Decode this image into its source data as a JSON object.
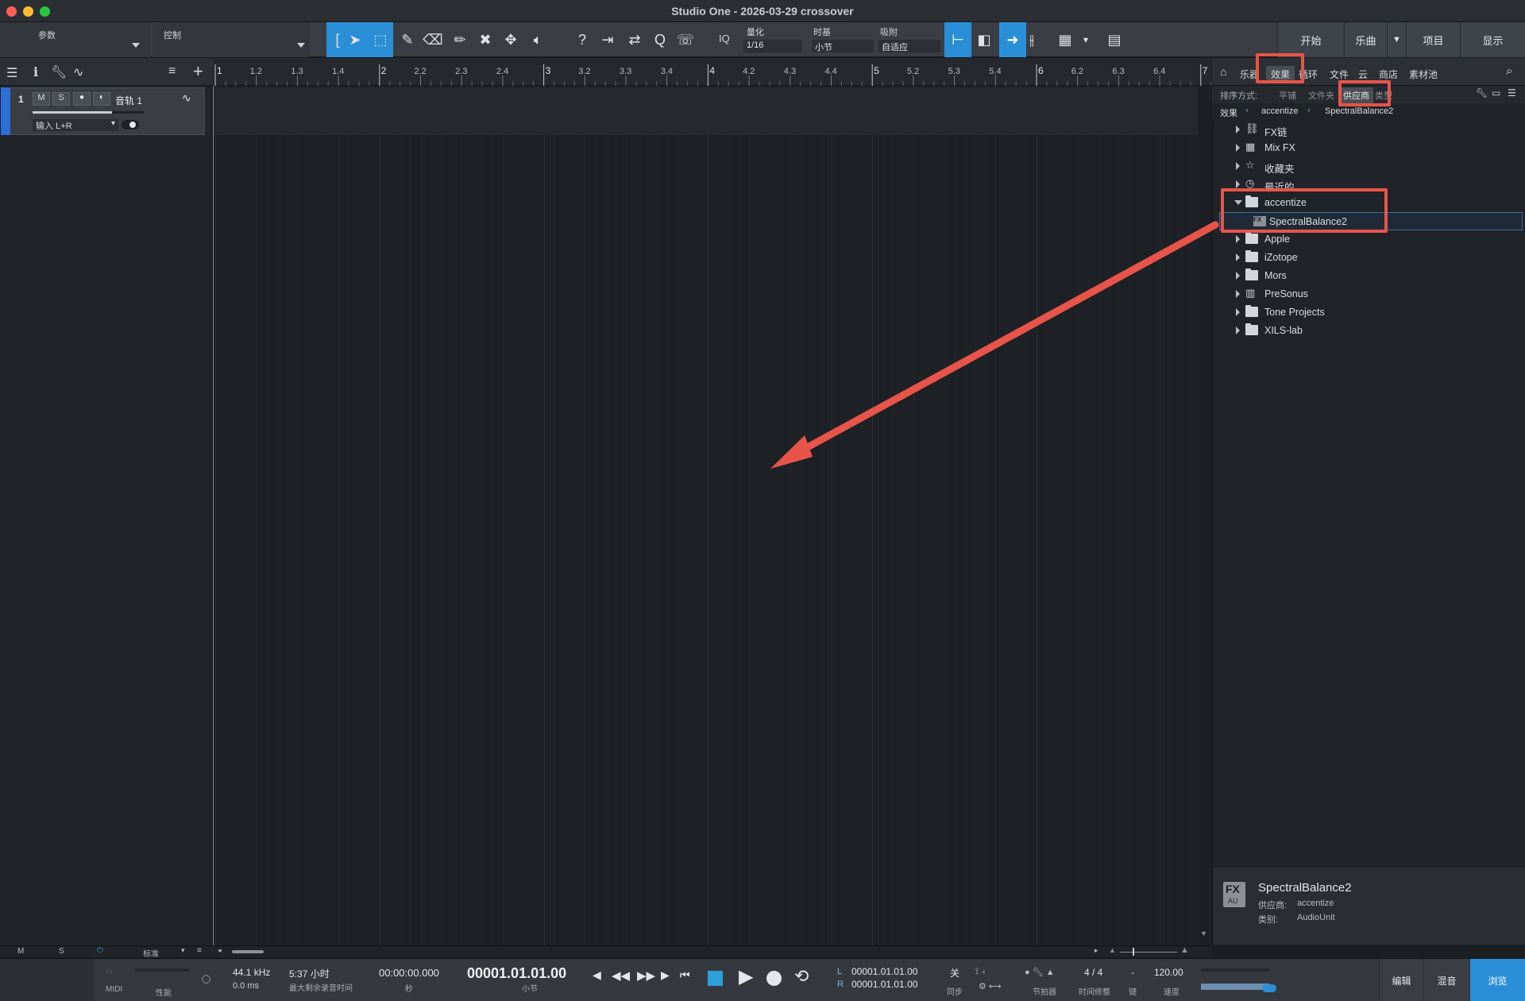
{
  "window": {
    "title": "Studio One - 2026-03-29 crossover"
  },
  "toolbar": {
    "params_label": "参数",
    "control_label": "控制",
    "quantize": {
      "label": "量化",
      "value": "1/16"
    },
    "timebase": {
      "label": "时基",
      "value": "小节"
    },
    "snap": {
      "label": "吸附",
      "value": "自适应"
    },
    "iq": "IQ",
    "right_tabs": [
      "开始",
      "乐曲",
      "项目",
      "显示"
    ]
  },
  "ruler": {
    "labels": [
      "1",
      "1.2",
      "1.3",
      "1.4",
      "2",
      "2.2",
      "2.3",
      "2.4",
      "3",
      "3.2",
      "3.3",
      "3.4",
      "4",
      "4.2",
      "4.3",
      "4.4",
      "5",
      "5.2",
      "5.3",
      "5.4",
      "6",
      "6.2",
      "6.3",
      "6.4",
      "7"
    ]
  },
  "track": {
    "number": "1",
    "name": "音轨 1",
    "mute": "M",
    "solo": "S",
    "input": "输入 L+R"
  },
  "browser": {
    "tabs": [
      "乐器",
      "效果",
      "循环",
      "文件",
      "云",
      "商店",
      "素材池"
    ],
    "sort_label": "排序方式:",
    "sort_options": [
      "平铺",
      "文件夹",
      "供应商",
      "类型"
    ],
    "breadcrumb": [
      "效果",
      "accentize",
      "SpectralBalance2"
    ],
    "tree": [
      {
        "label": "FX链",
        "icon": "fx-chain-icon",
        "open": false
      },
      {
        "label": "Mix FX",
        "icon": "mixfx-icon",
        "open": false
      },
      {
        "label": "收藏夹",
        "icon": "star-icon",
        "open": false
      },
      {
        "label": "最近的",
        "icon": "clock-icon",
        "open": false
      },
      {
        "label": "accentize",
        "icon": "folder-open-icon",
        "open": true
      },
      {
        "label": "SpectralBalance2",
        "icon": "fx-plugin-icon",
        "child": true
      },
      {
        "label": "Apple",
        "icon": "folder-icon",
        "open": false
      },
      {
        "label": "iZotope",
        "icon": "folder-icon",
        "open": false
      },
      {
        "label": "Mors",
        "icon": "folder-icon",
        "open": false
      },
      {
        "label": "PreSonus",
        "icon": "presonus-icon",
        "open": false
      },
      {
        "label": "Tone Projects",
        "icon": "folder-icon",
        "open": false
      },
      {
        "label": "XILS-lab",
        "icon": "folder-icon",
        "open": false
      }
    ],
    "info": {
      "badge_top": "FX",
      "badge_bottom": "AU",
      "name": "SpectralBalance2",
      "vendor_label": "供应商:",
      "vendor": "accentize",
      "category_label": "类别:",
      "category": "AudioUnit"
    }
  },
  "status": {
    "m": "M",
    "s": "S",
    "mode": "标准"
  },
  "transport": {
    "midi": "MIDI",
    "perf": "性能",
    "sample_rate": "44.1 kHz",
    "latency": "0.0 ms",
    "record_time": "5:37 小时",
    "record_time_label": "最大剩余录音时间",
    "time": "00:00:00.000",
    "time_label": "秒",
    "bars": "00001.01.01.00",
    "bars_label": "小节",
    "loop_l": "00001.01.01.00",
    "loop_r": "00001.01.01.00",
    "L": "L",
    "R": "R",
    "sync": "关",
    "sync_label": "同步",
    "metronome_label": "节拍器",
    "signature": "4 / 4",
    "signature_label": "时间修整",
    "key": "-",
    "key_label": "键",
    "tempo": "120.00",
    "tempo_label": "速度",
    "bottom_tabs": [
      "编辑",
      "混音",
      "浏览"
    ]
  },
  "colors": {
    "accent": "#2b8fd8",
    "annotation": "#e8544a",
    "panel": "#202327"
  }
}
